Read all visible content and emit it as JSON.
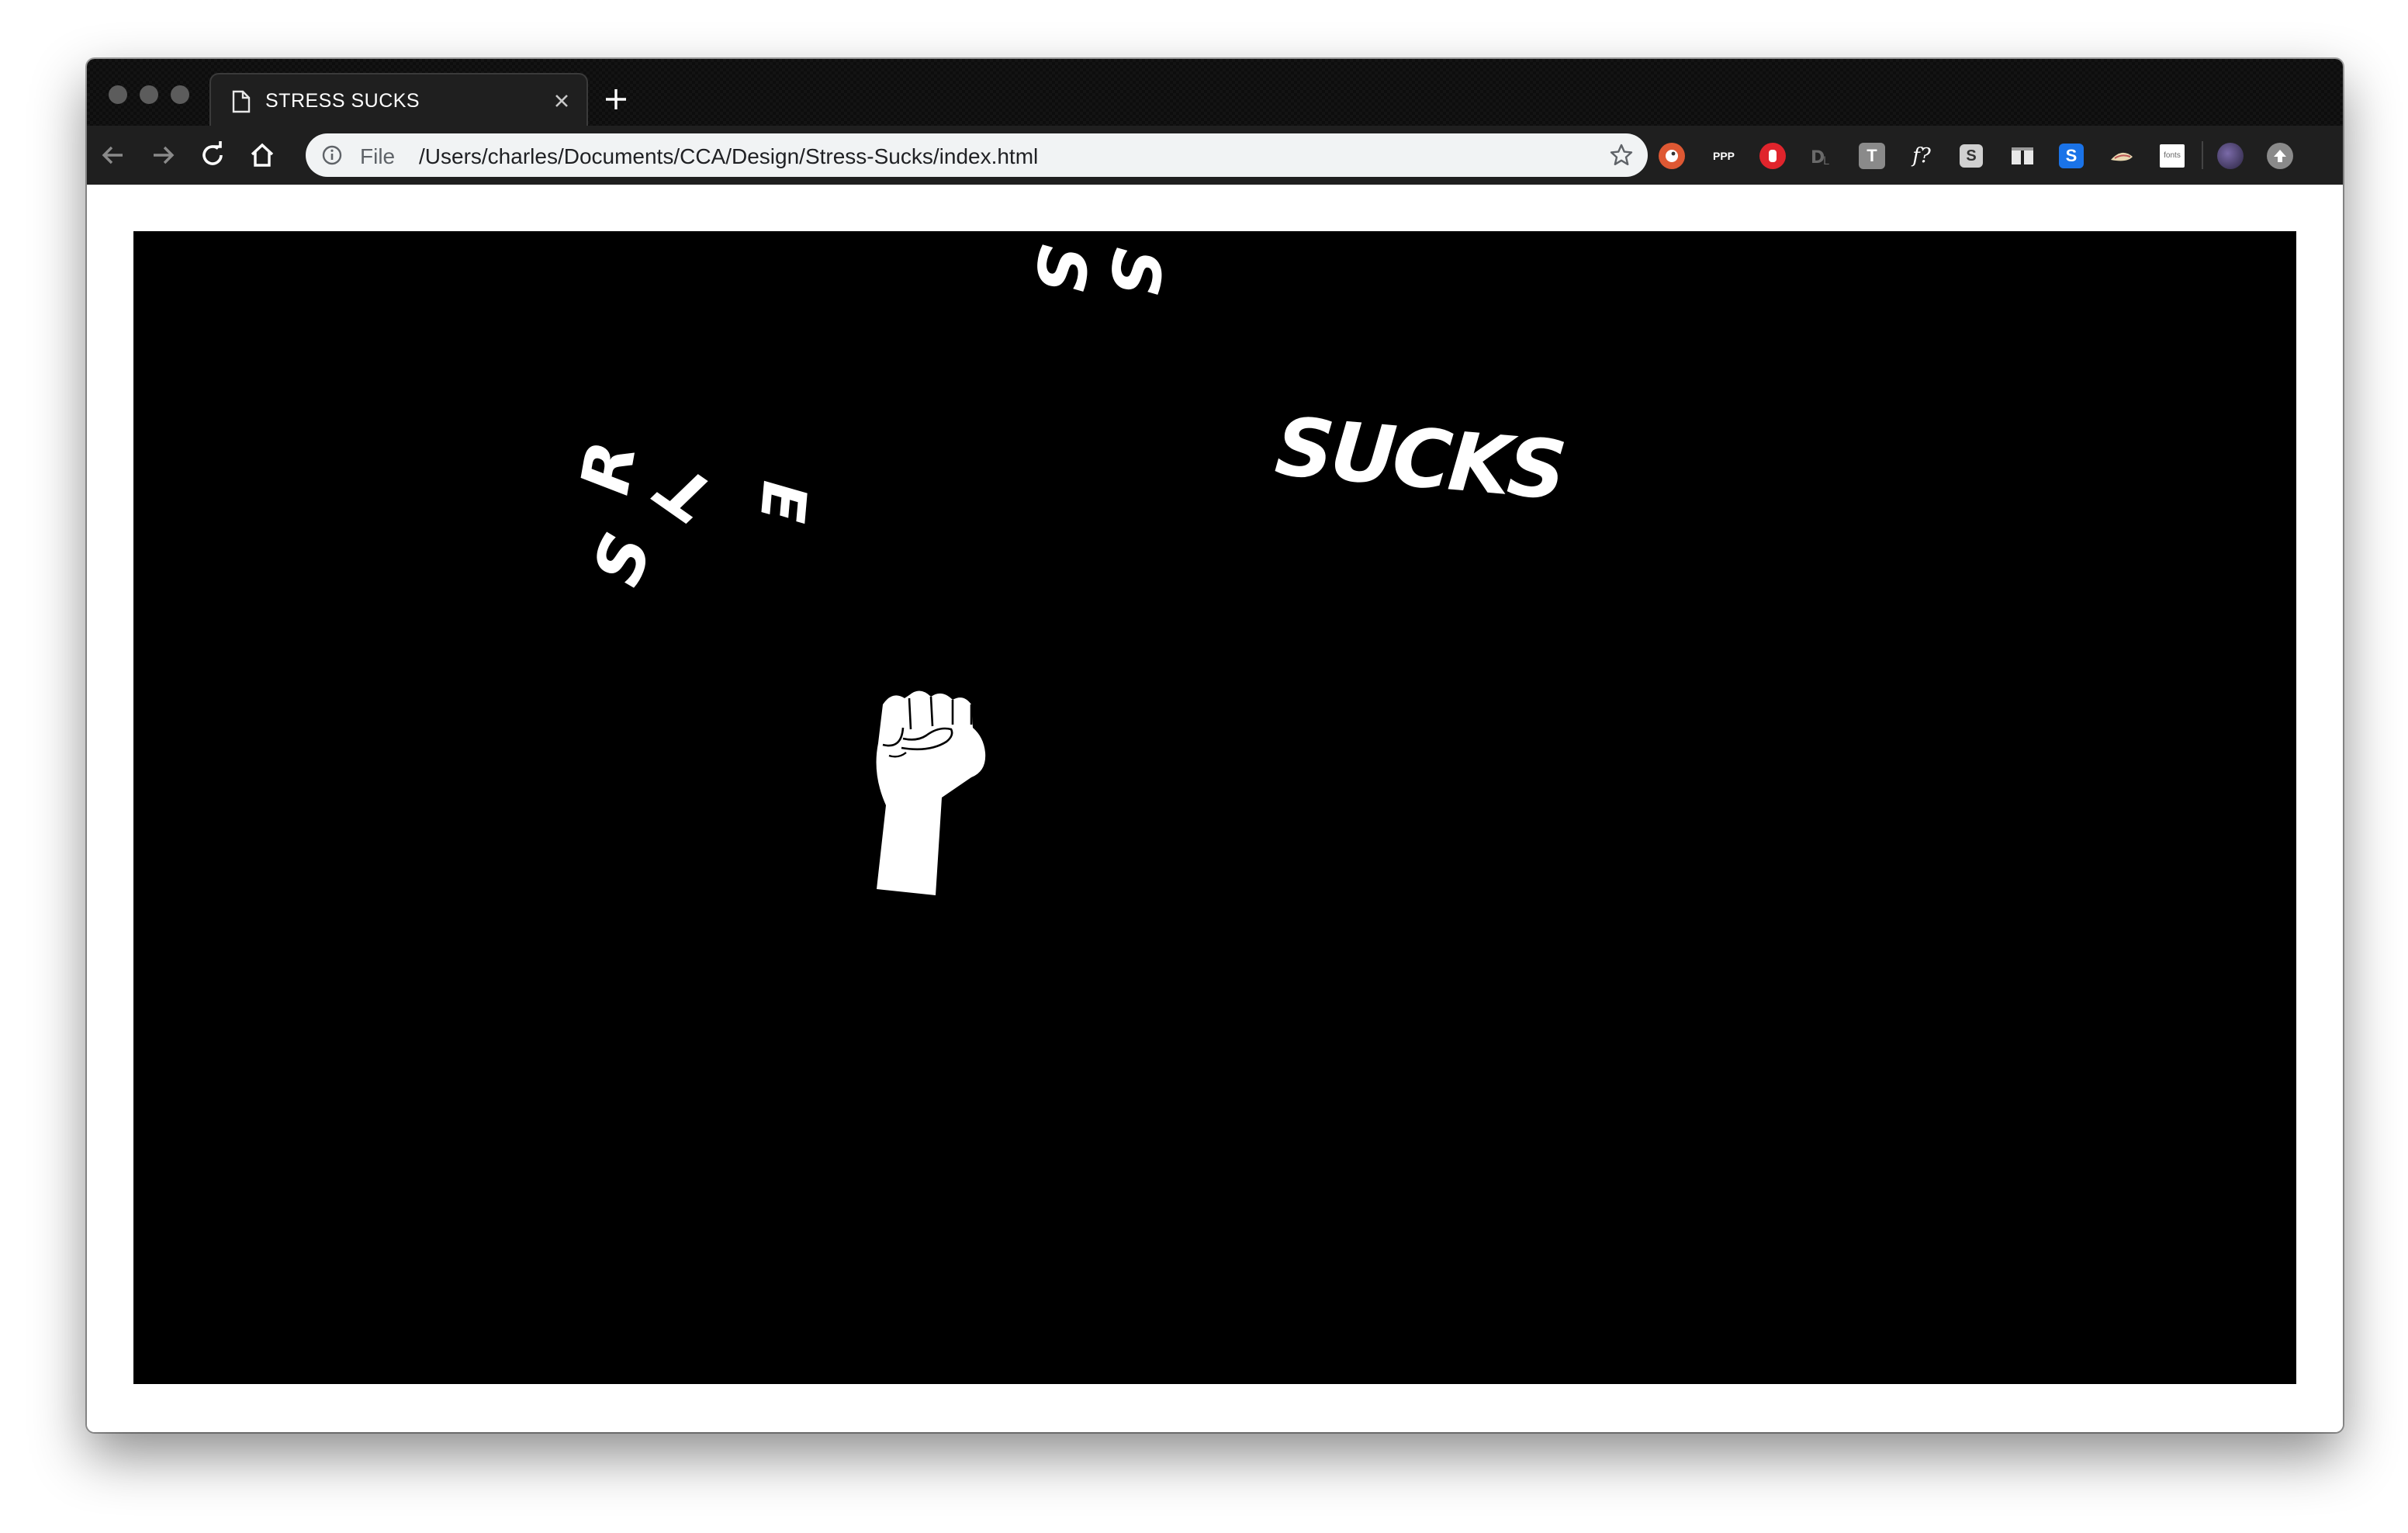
{
  "browser": {
    "tab": {
      "title": "STRESS SUCKS",
      "icon": "document-icon"
    },
    "omnibox": {
      "scheme_label": "File",
      "url": "/Users/charles/Documents/CCA/Design/Stress-Sucks/index.html"
    },
    "extensions": [
      {
        "name": "duckduckgo-icon",
        "color": "#de5833"
      },
      {
        "name": "ppp-icon",
        "label": "PPP",
        "color": "#1f1f1f"
      },
      {
        "name": "adblock-icon",
        "color": "#e0242c"
      },
      {
        "name": "dl-icon",
        "color": "#1f1f1f"
      },
      {
        "name": "text-t-icon",
        "label": "T",
        "color": "#8a8a8a"
      },
      {
        "name": "whatfont-icon",
        "label": "f?",
        "color": "#1f1f1f"
      },
      {
        "name": "s-grey-icon",
        "label": "S",
        "color": "#d0d0d0"
      },
      {
        "name": "columns-icon",
        "color": "#1f1f1f"
      },
      {
        "name": "s-blue-icon",
        "label": "S",
        "color": "#1a73e8"
      },
      {
        "name": "wappalyzer-icon",
        "color": "#1f1f1f"
      },
      {
        "name": "fonts-icon",
        "label": "fonts",
        "color": "#ffffff"
      }
    ]
  },
  "page": {
    "letters_word": [
      "S",
      "T",
      "R",
      "E",
      "S",
      "S"
    ],
    "sucks_word": "SUCKS",
    "colors": {
      "background": "#000000",
      "foreground": "#ffffff"
    },
    "graphic": "raised-fist-icon"
  }
}
